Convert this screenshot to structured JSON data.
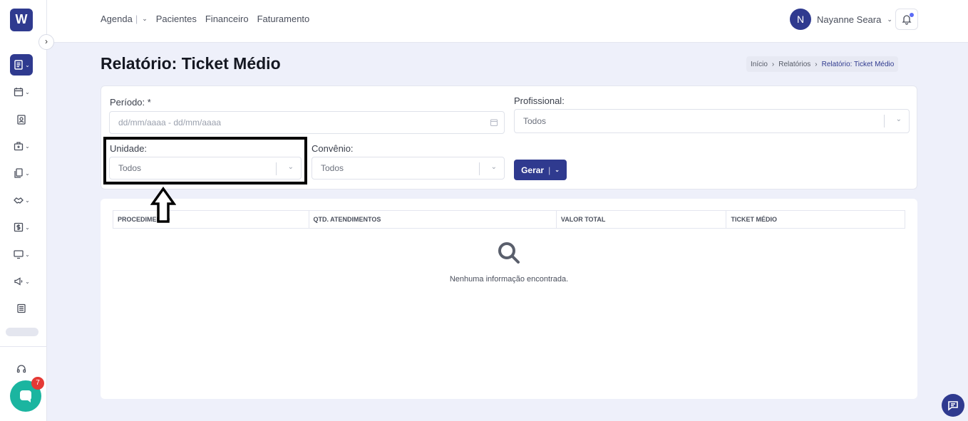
{
  "app": {
    "logo_letter": "W"
  },
  "topnav": {
    "items": [
      "Agenda",
      "Pacientes",
      "Financeiro",
      "Faturamento"
    ],
    "separator": "|"
  },
  "user": {
    "initial": "N",
    "name": "Nayanne Seara"
  },
  "page": {
    "title": "Relatório: Ticket Médio",
    "breadcrumb": [
      "Início",
      "Relatórios",
      "Relatório: Ticket Médio"
    ]
  },
  "filters": {
    "periodo_label": "Período: *",
    "periodo_placeholder": "dd/mm/aaaa - dd/mm/aaaa",
    "profissional_label": "Profissional:",
    "profissional_value": "Todos",
    "unidade_label": "Unidade:",
    "unidade_value": "Todos",
    "convenio_label": "Convênio:",
    "convenio_value": "Todos",
    "generate_label": "Gerar"
  },
  "table": {
    "columns": [
      "PROCEDIMENTO",
      "QTD. ATENDIMENTOS",
      "VALOR TOTAL",
      "TICKET MÉDIO"
    ],
    "empty_message": "Nenhuma informação encontrada."
  },
  "chat": {
    "badge_count": "7"
  },
  "colors": {
    "primary": "#2f3a8f",
    "chat": "#1bb5a0",
    "badge": "#e53935"
  }
}
